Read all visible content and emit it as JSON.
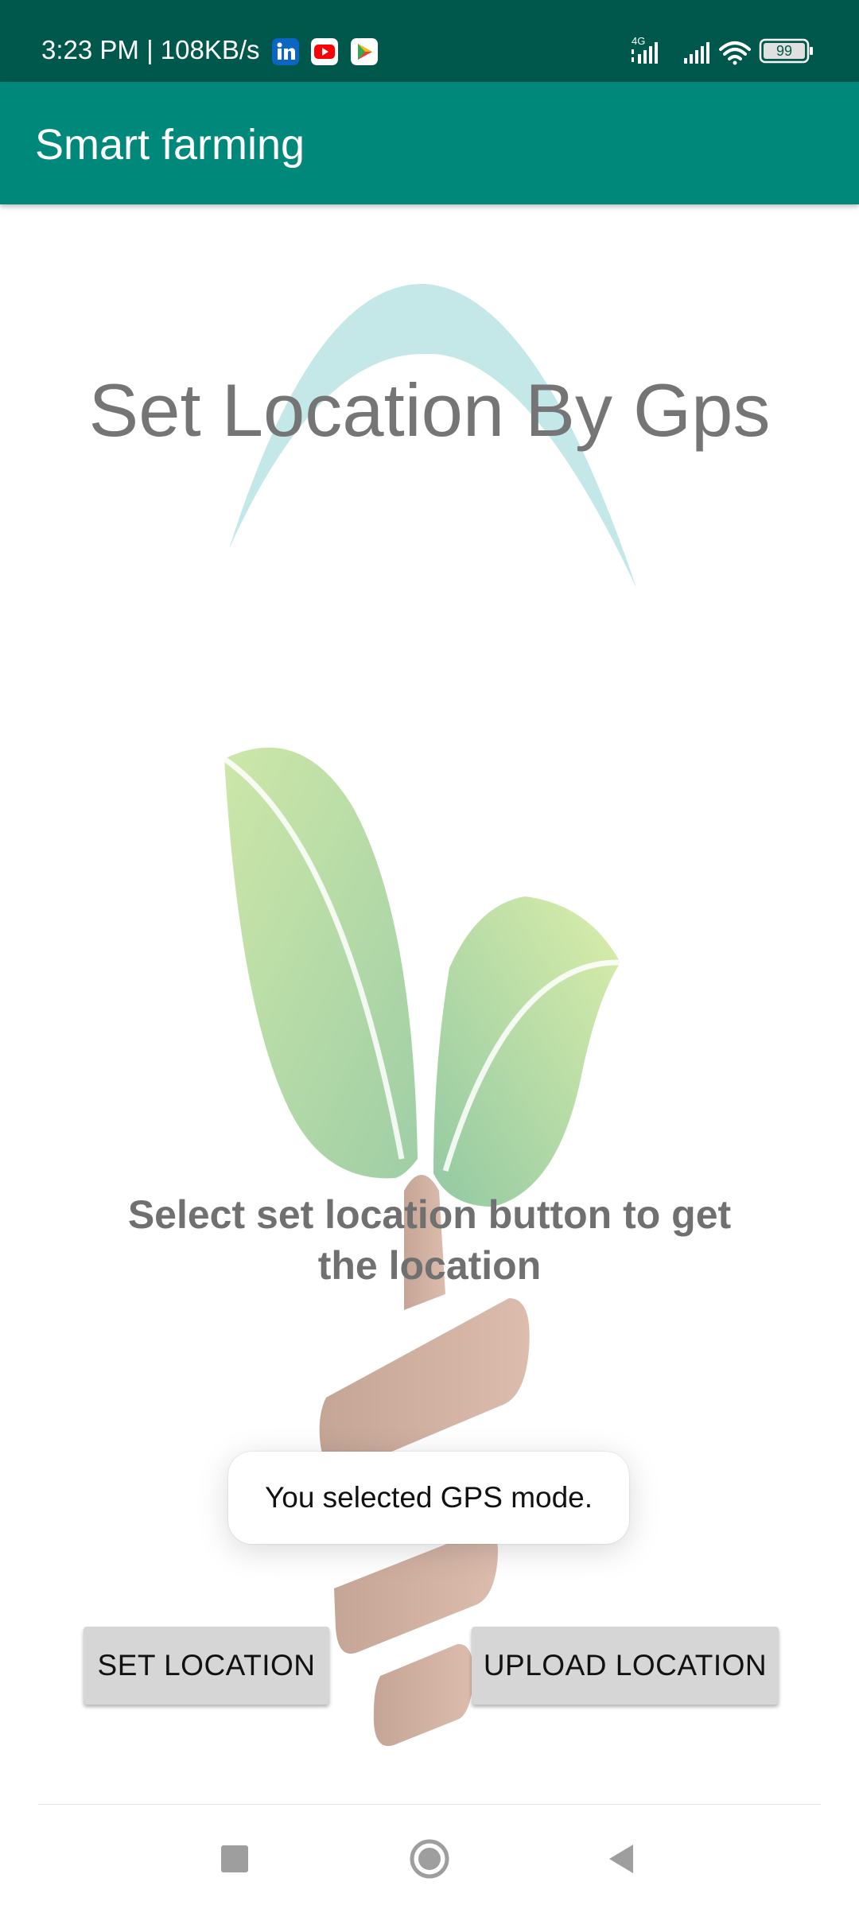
{
  "status_bar": {
    "time_speed": "3:23 PM | 108KB/s",
    "network": "4G",
    "battery": "99",
    "notification_icons": [
      "linkedin-icon",
      "youtube-icon",
      "play-games-icon"
    ],
    "colors": {
      "background": "#00574b"
    }
  },
  "app_bar": {
    "title": "Smart farming",
    "colors": {
      "background": "#00897b"
    }
  },
  "main": {
    "heading": "Set Location By Gps",
    "instruction": "Select set location button to get the location",
    "illustration": "plant-sprout-illustration"
  },
  "toast": {
    "message": "You selected GPS mode."
  },
  "buttons": {
    "set_location": "SET LOCATION",
    "upload_location": "UPLOAD LOCATION"
  },
  "nav_bar": {
    "items": [
      "recent-apps-icon",
      "home-icon",
      "back-icon"
    ]
  }
}
